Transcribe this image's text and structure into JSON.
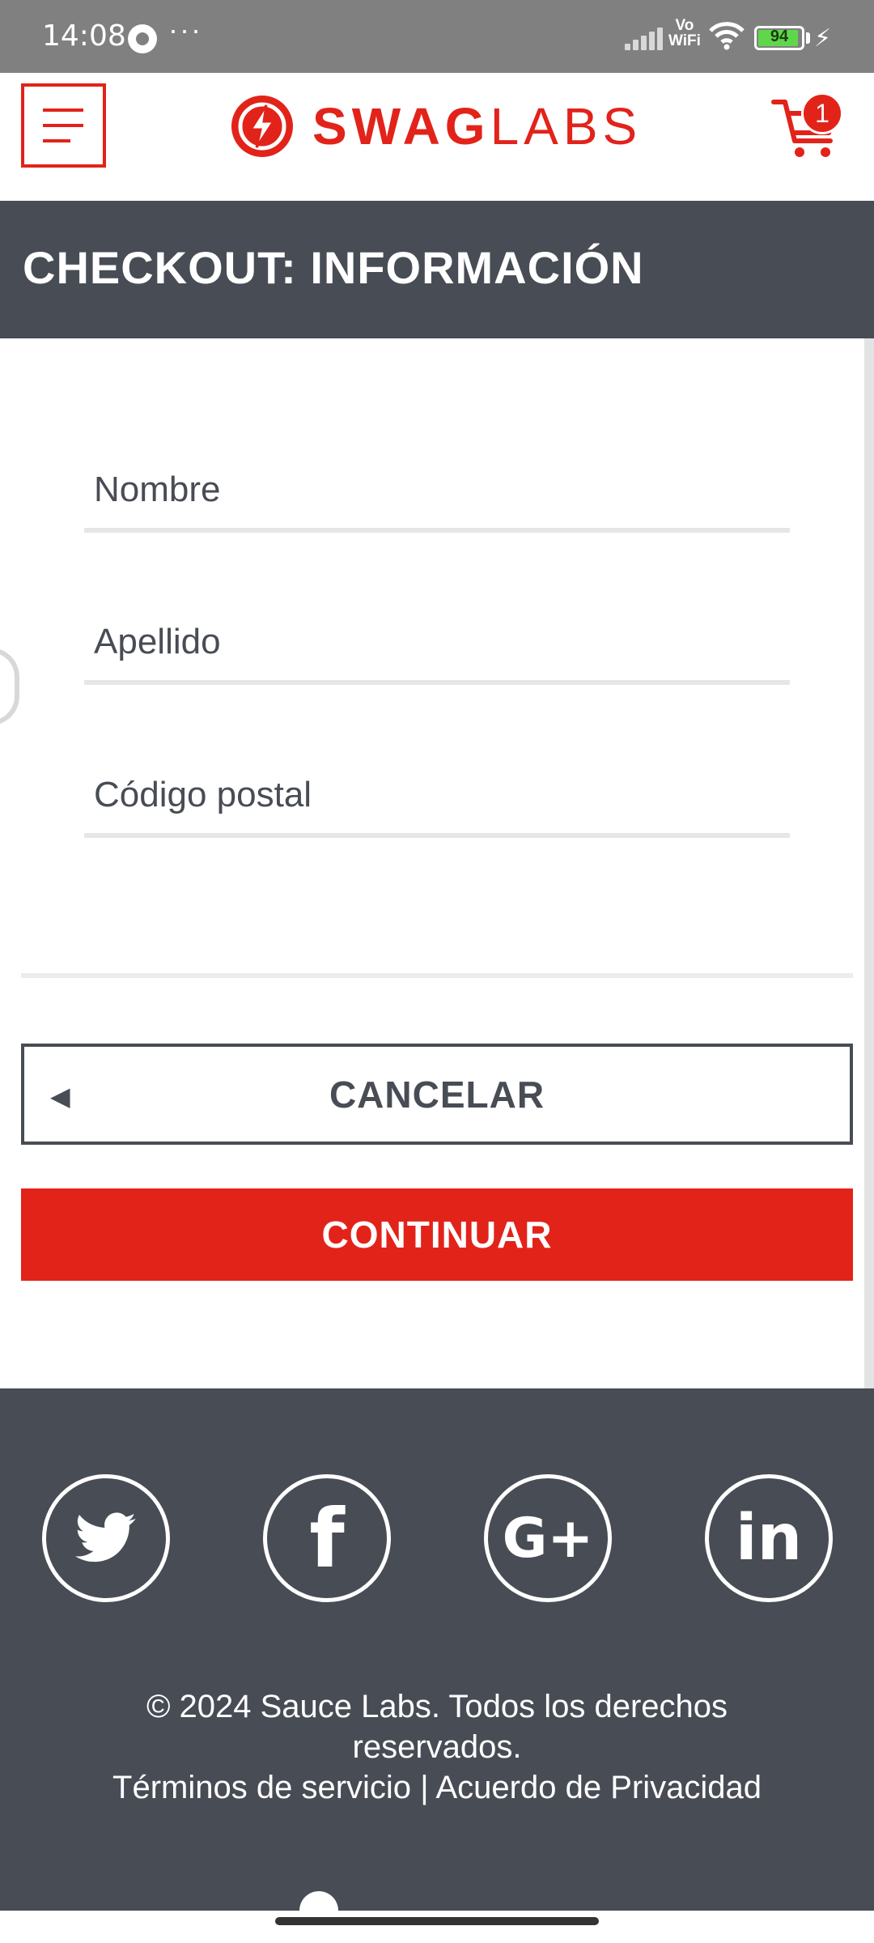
{
  "status_bar": {
    "time": "14:08",
    "more": "···",
    "vowifi_top": "Vo",
    "vowifi_bottom": "WiFi",
    "battery": "94",
    "battery_level": 0.94
  },
  "header": {
    "logo_bold": "SWAG",
    "logo_light": "LABS",
    "cart_count": "1",
    "accent_color": "#e2231a"
  },
  "page": {
    "title": "CHECKOUT: INFORMACIÓN"
  },
  "form": {
    "first_name_placeholder": "Nombre",
    "last_name_placeholder": "Apellido",
    "postal_code_placeholder": "Código postal",
    "first_name_value": "",
    "last_name_value": "",
    "postal_code_value": ""
  },
  "buttons": {
    "cancel": "CANCELAR",
    "continue": "CONTINUAR"
  },
  "footer": {
    "facebook": "f",
    "google": "G+",
    "linkedin": "in",
    "copyright": "© 2024 Sauce Labs. Todos los derechos reservados.",
    "terms": "Términos de servicio",
    "separator": "|",
    "privacy": "Acuerdo de Privacidad",
    "bg_color": "#484c55"
  }
}
